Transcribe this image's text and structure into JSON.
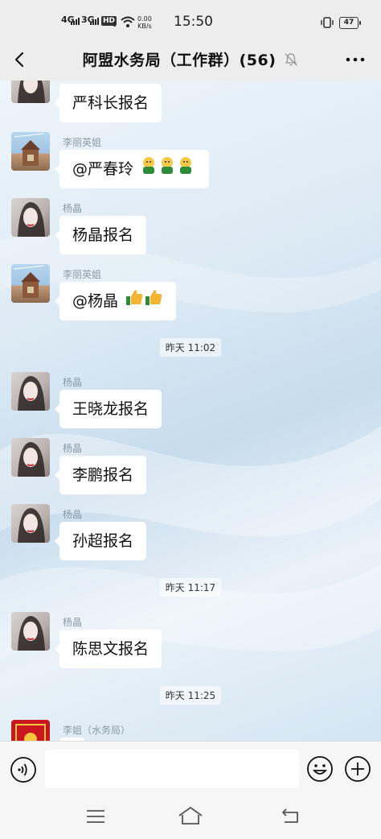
{
  "status_bar": {
    "network1": "4G",
    "network2": "3G",
    "hd": "HD",
    "sim": "1",
    "speed_value": "0.00",
    "speed_unit": "KB/s",
    "time": "15:50",
    "battery": "47"
  },
  "header": {
    "title": "阿盟水务局（工作群）(56)",
    "muted_icon": "bell-off-icon",
    "more_icon": "more-dots-icon",
    "back_icon": "chevron-left-icon"
  },
  "messages": [
    {
      "sender": "",
      "text": "严科长报名"
    },
    {
      "sender": "李丽英姐",
      "text": "@严春玲"
    },
    {
      "sender": "杨晶",
      "text": "杨晶报名"
    },
    {
      "sender": "李丽英姐",
      "text": "@杨晶"
    },
    {
      "sender": "杨晶",
      "text": "王晓龙报名"
    },
    {
      "sender": "杨晶",
      "text": "李鹏报名"
    },
    {
      "sender": "杨晶",
      "text": "孙超报名"
    },
    {
      "sender": "杨晶",
      "text": "陈思文报名"
    },
    {
      "sender": "李姐（水务局）",
      "text": ""
    }
  ],
  "timestamps": [
    "昨天 11:02",
    "昨天 11:17",
    "昨天 11:25"
  ],
  "input_bar": {
    "voice_icon": "voice-icon",
    "emoji_icon": "smile-icon",
    "add_icon": "plus-icon",
    "value": ""
  },
  "nav_bar": {
    "menu_icon": "menu-icon",
    "home_icon": "home-icon",
    "back_icon": "back-icon"
  },
  "colors": {
    "bubble": "#ffffff",
    "background": "#ededed",
    "sender_text": "#8a9aa5"
  }
}
